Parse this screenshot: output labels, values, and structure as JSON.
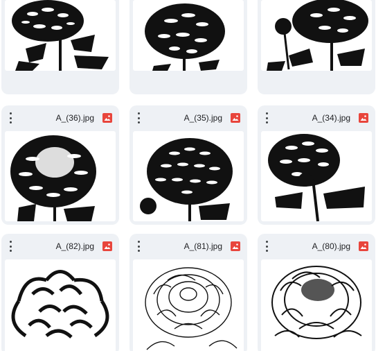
{
  "files": [
    {
      "name": "",
      "icon": "image-file-icon"
    },
    {
      "name": "",
      "icon": "image-file-icon"
    },
    {
      "name": "",
      "icon": "image-file-icon"
    },
    {
      "name": "A_(36).jpg",
      "icon": "image-file-icon"
    },
    {
      "name": "A_(35).jpg",
      "icon": "image-file-icon"
    },
    {
      "name": "A_(34).jpg",
      "icon": "image-file-icon"
    },
    {
      "name": "A_(82).jpg",
      "icon": "image-file-icon"
    },
    {
      "name": "A_(81).jpg",
      "icon": "image-file-icon"
    },
    {
      "name": "A_(80).jpg",
      "icon": "image-file-icon"
    }
  ],
  "colors": {
    "card_bg": "#eef1f5",
    "image_icon": "#e8453c",
    "text": "#202124"
  }
}
